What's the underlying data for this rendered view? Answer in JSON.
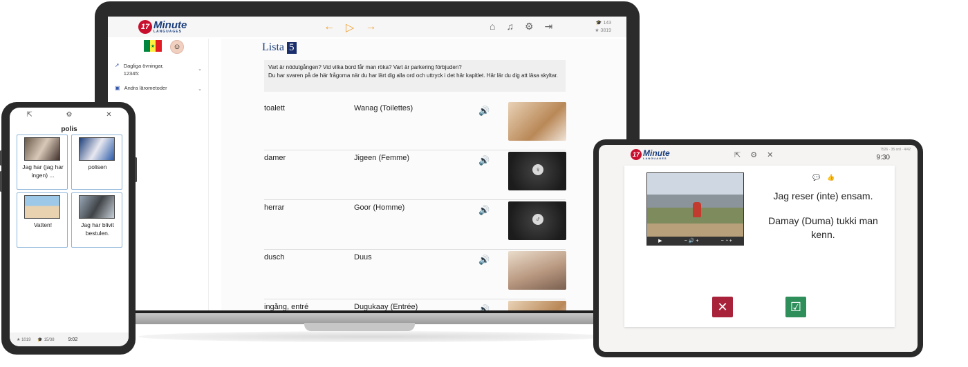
{
  "laptop": {
    "logo": {
      "number": "17",
      "name": "Minute",
      "sub": "LANGUAGES"
    },
    "nav": {
      "back": "←",
      "play": "▷",
      "forward": "→"
    },
    "top_icons": {
      "home": "⌂",
      "music": "♫",
      "settings": "⚙",
      "logout": "⇥"
    },
    "stats": {
      "lessons": "143",
      "stars": "3819"
    },
    "flag_colors": [
      "#00853f",
      "#fdef42",
      "#e31b23"
    ],
    "sidebar": {
      "items": [
        {
          "label": "Dagliga övningar, 12345:"
        },
        {
          "label": "Andra lärometoder"
        }
      ]
    },
    "lista": {
      "label": "Lista",
      "number": "5"
    },
    "info": {
      "line1": "Vart är nödutgången? Vid vilka bord får man röka? Vart är parkering förbjuden?",
      "line2": "Du har svaren på de här frågorna när du har lärt dig alla ord och uttryck i det här kapitlet. Här lär du dig att läsa skyltar."
    },
    "words": [
      {
        "sv": "toalett",
        "tr": "Wanag (Toilettes)"
      },
      {
        "sv": "damer",
        "tr": "Jigeen (Femme)"
      },
      {
        "sv": "herrar",
        "tr": "Goor (Homme)"
      },
      {
        "sv": "dusch",
        "tr": "Duus"
      },
      {
        "sv": "ingång, entré",
        "tr": "Dugukaay (Entrée)"
      }
    ]
  },
  "phone": {
    "title": "polis",
    "cards": [
      {
        "label": "Jag har (jag har ingen) ..."
      },
      {
        "label": "polisen"
      },
      {
        "label": "Vatten!"
      },
      {
        "label": "Jag har blivit bestulen."
      }
    ],
    "bottom": {
      "stars": "1019",
      "lessons": "15/38",
      "time": "9:02"
    }
  },
  "tablet": {
    "logo": {
      "number": "17",
      "name": "Minute",
      "sub": "LANGUAGES"
    },
    "stats": "7526 · 35 ord · 4/42",
    "time": "9:30",
    "sentence_sv": "Jag reser (inte) ensam.",
    "sentence_tr": "Damay (Duma) tukki man kenn."
  }
}
